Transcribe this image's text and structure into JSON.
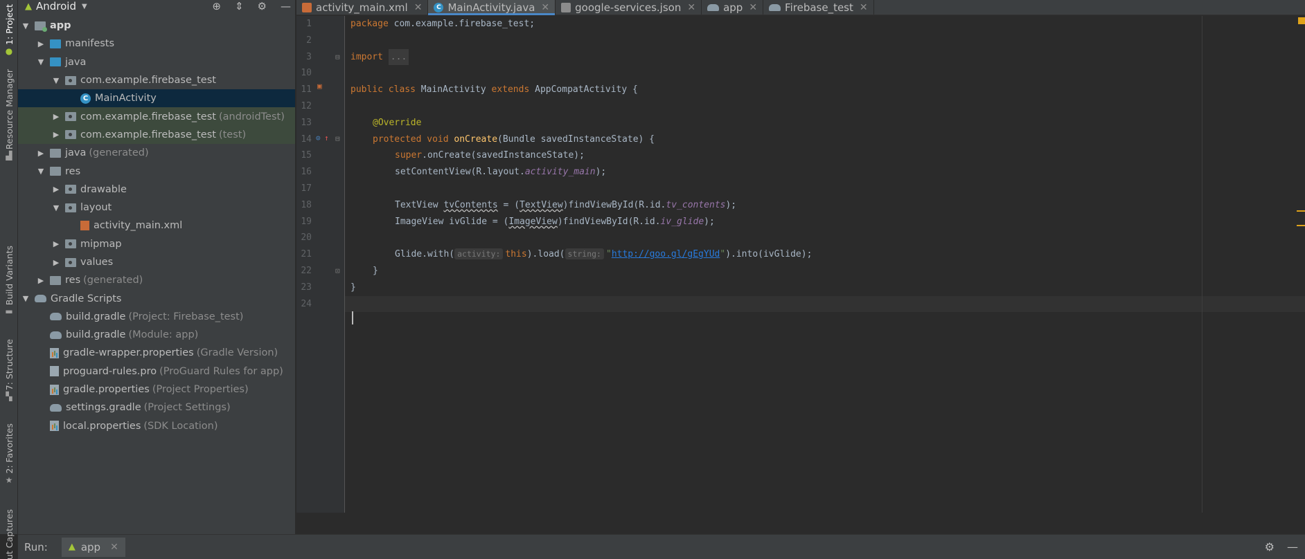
{
  "left_strip": {
    "tabs": [
      {
        "label": "1: Project",
        "icon": "android-icon"
      },
      {
        "label": "Resource Manager",
        "icon": "resource-manager-icon"
      },
      {
        "label": "Build Variants",
        "icon": "build-variants-icon"
      },
      {
        "label": "7: Structure",
        "icon": "structure-icon"
      },
      {
        "label": "2: Favorites",
        "icon": "star-icon"
      },
      {
        "label": "Layout Captures",
        "icon": "captures-icon"
      }
    ]
  },
  "project_panel": {
    "view_name": "Android",
    "tools": [
      "target-icon",
      "collapse-icon",
      "gear-icon",
      "minimize-icon"
    ],
    "tree": [
      {
        "label": "app",
        "suffix": ""
      },
      {
        "label": "manifests",
        "suffix": ""
      },
      {
        "label": "java",
        "suffix": ""
      },
      {
        "label": "com.example.firebase_test",
        "suffix": ""
      },
      {
        "label": "MainActivity",
        "suffix": ""
      },
      {
        "label": "com.example.firebase_test",
        "suffix": "(androidTest)"
      },
      {
        "label": "com.example.firebase_test",
        "suffix": "(test)"
      },
      {
        "label": "java",
        "suffix": "(generated)"
      },
      {
        "label": "res",
        "suffix": ""
      },
      {
        "label": "drawable",
        "suffix": ""
      },
      {
        "label": "layout",
        "suffix": ""
      },
      {
        "label": "activity_main.xml",
        "suffix": ""
      },
      {
        "label": "mipmap",
        "suffix": ""
      },
      {
        "label": "values",
        "suffix": ""
      },
      {
        "label": "res",
        "suffix": "(generated)"
      },
      {
        "label": "Gradle Scripts",
        "suffix": ""
      },
      {
        "label": "build.gradle",
        "suffix": "(Project: Firebase_test)"
      },
      {
        "label": "build.gradle",
        "suffix": "(Module: app)"
      },
      {
        "label": "gradle-wrapper.properties",
        "suffix": "(Gradle Version)"
      },
      {
        "label": "proguard-rules.pro",
        "suffix": "(ProGuard Rules for app)"
      },
      {
        "label": "gradle.properties",
        "suffix": "(Project Properties)"
      },
      {
        "label": "settings.gradle",
        "suffix": "(Project Settings)"
      },
      {
        "label": "local.properties",
        "suffix": "(SDK Location)"
      }
    ]
  },
  "editor_tabs": [
    {
      "label": "activity_main.xml",
      "icon": "xml-file-icon"
    },
    {
      "label": "MainActivity.java",
      "icon": "java-class-icon",
      "active": true
    },
    {
      "label": "google-services.json",
      "icon": "json-file-icon"
    },
    {
      "label": "app",
      "icon": "gradle-icon"
    },
    {
      "label": "Firebase_test",
      "icon": "gradle-icon"
    }
  ],
  "editor": {
    "line_numbers": [
      "1",
      "2",
      "3",
      "10",
      "11",
      "12",
      "13",
      "14",
      "15",
      "16",
      "17",
      "18",
      "19",
      "20",
      "21",
      "22",
      "23",
      "24"
    ],
    "code": {
      "l1_kw": "package",
      "l1_rest": " com.example.firebase_test;",
      "l3_kw": "import",
      "l3_fold": "...",
      "l11_kw": "public class",
      "l11_name": " MainActivity ",
      "l11_ext": "extends",
      "l11_rest": " AppCompatActivity {",
      "l13_ann": "@Override",
      "l14_kw": "protected void",
      "l14_fn": "onCreate",
      "l14_rest": "(Bundle savedInstanceState) {",
      "l15_kw": "super",
      "l15_rest": ".onCreate(savedInstanceState);",
      "l16_a": "setContentView(R.layout.",
      "l16_field": "activity_main",
      "l16_b": ");",
      "l18_a": "TextView ",
      "l18_var": "tvContents",
      "l18_b": " = (",
      "l18_cast": "TextView",
      "l18_c": ")findViewById(R.id.",
      "l18_field": "tv_contents",
      "l18_d": ");",
      "l19_a": "ImageView ivGlide = (",
      "l19_cast": "ImageView",
      "l19_c": ")findViewById(R.id.",
      "l19_field": "iv_glide",
      "l19_d": ");",
      "l21_a": "Glide.with(",
      "l21_hint1": "activity:",
      "l21_this": "this",
      "l21_b": ").load(",
      "l21_hint2": "string:",
      "l21_q1": "\"",
      "l21_url": "http://goo.gl/gEgYUd",
      "l21_q2": "\"",
      "l21_c": ").into(ivGlide);",
      "l22": "}",
      "l23": "}"
    }
  },
  "run_bar": {
    "label": "Run:",
    "tab_label": "app",
    "tools": [
      "gear-icon",
      "minimize-icon"
    ]
  },
  "colors": {
    "keyword": "#cc7832",
    "annotation": "#bbb529",
    "method": "#ffc66d",
    "field": "#9876aa",
    "link": "#287bde",
    "selection": "#0d293e",
    "accent_tab": "#4a88c7"
  }
}
